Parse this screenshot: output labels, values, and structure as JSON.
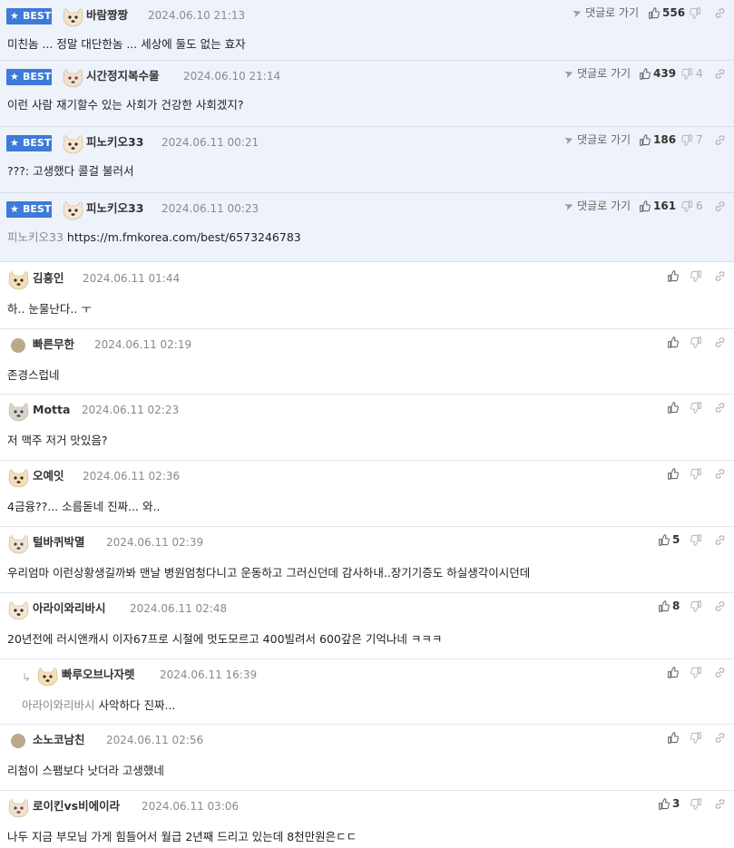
{
  "colors": {
    "best_badge": "#3d7ad9",
    "best_row_bg": "#eef2fa",
    "divider": "#e3e6ec"
  },
  "labels": {
    "best": "BEST",
    "reply_go": "댓글로 가기"
  },
  "comments": [
    {
      "best": true,
      "avatar": "dog-avatar",
      "author": "바람짱짱",
      "date": "2024.06.10 21:13",
      "up": "556",
      "down": "",
      "text": "미친놈 ... 정말 대단한놈 ... 세상에 둘도 없는 효자"
    },
    {
      "best": true,
      "avatar": "dog-avatar",
      "author": "시간정지복수물",
      "date": "2024.06.10 21:14",
      "up": "439",
      "down": "4",
      "text": "이런 사람 재기할수 있는 사회가 건강한 사회겠지?"
    },
    {
      "best": true,
      "avatar": "dog-avatar",
      "author": "피노키오33",
      "date": "2024.06.11 00:21",
      "up": "186",
      "down": "7",
      "text": "???: 고생했다 콜걸 불러서"
    },
    {
      "best": true,
      "avatar": "dog-avatar",
      "author": "피노키오33",
      "date": "2024.06.11 00:23",
      "up": "161",
      "down": "6",
      "mention": "피노키오33",
      "text": "https://m.fmkorea.com/best/6573246783"
    },
    {
      "best": false,
      "avatar": "dog-avatar",
      "author": "김흥인",
      "date": "2024.06.11 01:44",
      "up": "",
      "text": "하.. 눈물난다.. ㅜ"
    },
    {
      "best": false,
      "avatar": "dot-avatar",
      "author": "빠른무한",
      "date": "2024.06.11 02:19",
      "up": "",
      "text": "존경스럽네"
    },
    {
      "best": false,
      "avatar": "dog-avatar",
      "author": "Motta",
      "date": "2024.06.11 02:23",
      "up": "",
      "text": "저 맥주 저거 맛있음?"
    },
    {
      "best": false,
      "avatar": "dog-avatar",
      "author": "오예잇",
      "date": "2024.06.11 02:36",
      "up": "",
      "text": "4금융??... 소름돋네 진짜... 와.."
    },
    {
      "best": false,
      "avatar": "dog-avatar",
      "author": "털바퀴박멸",
      "date": "2024.06.11 02:39",
      "up": "5",
      "text": "우리엄마 이런상황생길까봐 맨날 병원엄청다니고 운동하고 그러신던데 감사하내..장기기증도 하실생각이시던데"
    },
    {
      "best": false,
      "avatar": "dog-avatar",
      "author": "아라이와리바시",
      "date": "2024.06.11 02:48",
      "up": "8",
      "text": "20년전에 러시앤캐시 이자67프로 시절에 멋도모르고 400빌려서 600갚은 기억나네 ㅋㅋㅋ"
    },
    {
      "best": false,
      "reply": true,
      "avatar": "dog-avatar",
      "author": "빠루오브나자렛",
      "date": "2024.06.11 16:39",
      "up": "",
      "mention": "아라이와리바시",
      "text": "사악하다 진짜..."
    },
    {
      "best": false,
      "avatar": "dot-avatar",
      "author": "소노코남친",
      "date": "2024.06.11 02:56",
      "up": "",
      "text": "리첨이 스팸보다 낫더라 고생했네"
    },
    {
      "best": false,
      "avatar": "dog-avatar",
      "author": "로이킨vs비에이라",
      "date": "2024.06.11 03:06",
      "up": "3",
      "text": "나두 지금 부모님 가게 힘들어서 월급 2년째 드리고 있는데 8천만원은ㄷㄷ"
    }
  ]
}
